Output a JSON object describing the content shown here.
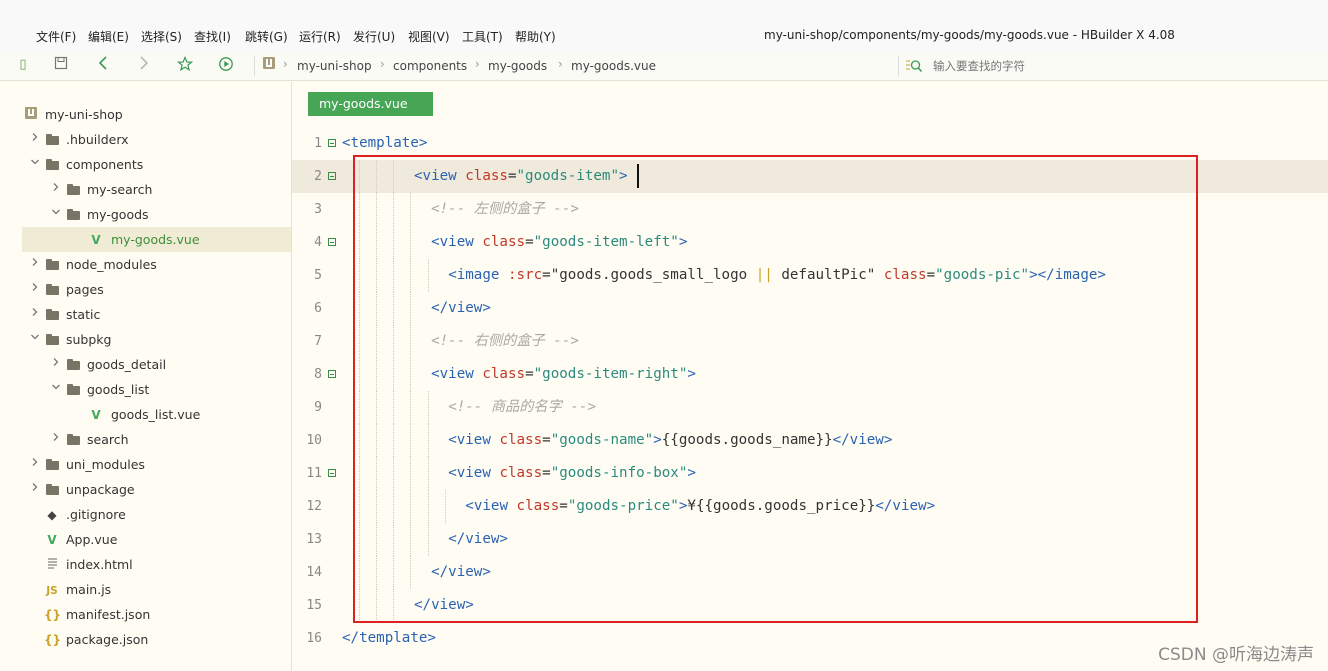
{
  "menu": [
    "文件(F)",
    "编辑(E)",
    "选择(S)",
    "查找(I)",
    "跳转(G)",
    "运行(R)",
    "发行(U)",
    "视图(V)",
    "工具(T)",
    "帮助(Y)"
  ],
  "window_title": "my-uni-shop/components/my-goods/my-goods.vue - HBuilder X 4.08",
  "toolbar": {
    "icons": [
      "sidebar-toggle-icon",
      "save-icon",
      "back-icon",
      "forward-icon",
      "star-icon",
      "run-icon"
    ],
    "breadcrumb": [
      "my-uni-shop",
      "components",
      "my-goods",
      "my-goods.vue"
    ],
    "search_placeholder": "输入要查找的字符"
  },
  "sidebar": {
    "items": [
      {
        "label": "my-uni-shop",
        "type": "project",
        "depth": 0
      },
      {
        "label": ".hbuilderx",
        "type": "folder",
        "depth": 1,
        "state": "collapsed"
      },
      {
        "label": "components",
        "type": "folder",
        "depth": 1,
        "state": "expanded"
      },
      {
        "label": "my-search",
        "type": "folder",
        "depth": 2,
        "state": "collapsed"
      },
      {
        "label": "my-goods",
        "type": "folder",
        "depth": 2,
        "state": "expanded"
      },
      {
        "label": "my-goods.vue",
        "type": "vue",
        "depth": 3,
        "selected": true
      },
      {
        "label": "node_modules",
        "type": "folder",
        "depth": 1,
        "state": "collapsed"
      },
      {
        "label": "pages",
        "type": "folder",
        "depth": 1,
        "state": "collapsed"
      },
      {
        "label": "static",
        "type": "folder",
        "depth": 1,
        "state": "collapsed"
      },
      {
        "label": "subpkg",
        "type": "folder",
        "depth": 1,
        "state": "expanded"
      },
      {
        "label": "goods_detail",
        "type": "folder",
        "depth": 2,
        "state": "collapsed"
      },
      {
        "label": "goods_list",
        "type": "folder",
        "depth": 2,
        "state": "expanded"
      },
      {
        "label": "goods_list.vue",
        "type": "vue",
        "depth": 3
      },
      {
        "label": "search",
        "type": "folder",
        "depth": 2,
        "state": "collapsed"
      },
      {
        "label": "uni_modules",
        "type": "folder",
        "depth": 1,
        "state": "collapsed"
      },
      {
        "label": "unpackage",
        "type": "folder",
        "depth": 1,
        "state": "collapsed"
      },
      {
        "label": ".gitignore",
        "type": "git",
        "depth": 1
      },
      {
        "label": "App.vue",
        "type": "vue",
        "depth": 1
      },
      {
        "label": "index.html",
        "type": "file",
        "depth": 1
      },
      {
        "label": "main.js",
        "type": "js",
        "depth": 1
      },
      {
        "label": "manifest.json",
        "type": "json",
        "depth": 1
      },
      {
        "label": "package.json",
        "type": "json",
        "depth": 1
      }
    ]
  },
  "editor": {
    "tab_label": "my-goods.vue",
    "current_line": 2,
    "lines": [
      {
        "n": "1",
        "fold": true,
        "indent": 0,
        "tokens": [
          [
            "tag",
            "<template>"
          ]
        ]
      },
      {
        "n": "2",
        "fold": true,
        "indent": 4,
        "tokens": [
          [
            "tag",
            "<view "
          ],
          [
            "attr",
            "class"
          ],
          [
            "plain",
            "="
          ],
          [
            "str",
            "\"goods-item\""
          ],
          [
            "tag",
            ">"
          ]
        ]
      },
      {
        "n": "3",
        "fold": false,
        "indent": 5,
        "tokens": [
          [
            "cmt",
            "<!-- 左侧的盒子 -->"
          ]
        ]
      },
      {
        "n": "4",
        "fold": true,
        "indent": 5,
        "tokens": [
          [
            "tag",
            "<view "
          ],
          [
            "attr",
            "class"
          ],
          [
            "plain",
            "="
          ],
          [
            "str",
            "\"goods-item-left\""
          ],
          [
            "tag",
            ">"
          ]
        ]
      },
      {
        "n": "5",
        "fold": false,
        "indent": 6,
        "tokens": [
          [
            "tag",
            "<image "
          ],
          [
            "attr",
            ":src"
          ],
          [
            "plain",
            "=\"goods.goods_small_logo "
          ],
          [
            "pipe",
            "||"
          ],
          [
            "plain",
            " defaultPic\" "
          ],
          [
            "attr",
            "class"
          ],
          [
            "plain",
            "="
          ],
          [
            "str",
            "\"goods-pic\""
          ],
          [
            "tag",
            "></image>"
          ]
        ]
      },
      {
        "n": "6",
        "fold": false,
        "indent": 5,
        "tokens": [
          [
            "tag",
            "</view>"
          ]
        ]
      },
      {
        "n": "7",
        "fold": false,
        "indent": 5,
        "tokens": [
          [
            "cmt",
            "<!-- 右侧的盒子 -->"
          ]
        ]
      },
      {
        "n": "8",
        "fold": true,
        "indent": 5,
        "tokens": [
          [
            "tag",
            "<view "
          ],
          [
            "attr",
            "class"
          ],
          [
            "plain",
            "="
          ],
          [
            "str",
            "\"goods-item-right\""
          ],
          [
            "tag",
            ">"
          ]
        ]
      },
      {
        "n": "9",
        "fold": false,
        "indent": 6,
        "tokens": [
          [
            "cmt",
            "<!-- 商品的名字 -->"
          ]
        ]
      },
      {
        "n": "10",
        "fold": false,
        "indent": 6,
        "tokens": [
          [
            "tag",
            "<view "
          ],
          [
            "attr",
            "class"
          ],
          [
            "plain",
            "="
          ],
          [
            "str",
            "\"goods-name\""
          ],
          [
            "tag",
            ">"
          ],
          [
            "plain",
            "{{goods.goods_name}}"
          ],
          [
            "tag",
            "</view>"
          ]
        ]
      },
      {
        "n": "11",
        "fold": true,
        "indent": 6,
        "tokens": [
          [
            "tag",
            "<view "
          ],
          [
            "attr",
            "class"
          ],
          [
            "plain",
            "="
          ],
          [
            "str",
            "\"goods-info-box\""
          ],
          [
            "tag",
            ">"
          ]
        ]
      },
      {
        "n": "12",
        "fold": false,
        "indent": 7,
        "tokens": [
          [
            "tag",
            "<view "
          ],
          [
            "attr",
            "class"
          ],
          [
            "plain",
            "="
          ],
          [
            "str",
            "\"goods-price\""
          ],
          [
            "tag",
            ">"
          ],
          [
            "plain",
            "¥{{goods.goods_price}}"
          ],
          [
            "tag",
            "</view>"
          ]
        ]
      },
      {
        "n": "13",
        "fold": false,
        "indent": 6,
        "tokens": [
          [
            "tag",
            "</view>"
          ]
        ]
      },
      {
        "n": "14",
        "fold": false,
        "indent": 5,
        "tokens": [
          [
            "tag",
            "</view>"
          ]
        ]
      },
      {
        "n": "15",
        "fold": false,
        "indent": 4,
        "tokens": [
          [
            "tag",
            "</view>"
          ]
        ]
      },
      {
        "n": "16",
        "fold": false,
        "indent": 0,
        "tokens": [
          [
            "tag",
            "</template>"
          ]
        ]
      }
    ]
  },
  "watermark": "CSDN @听海边涛声",
  "colors": {
    "accent": "#46a656",
    "highlight_box": "#e02020",
    "tag": "#2a62b2",
    "attr": "#c0392b",
    "string": "#2b8a7e",
    "comment": "#a9a9a0"
  }
}
